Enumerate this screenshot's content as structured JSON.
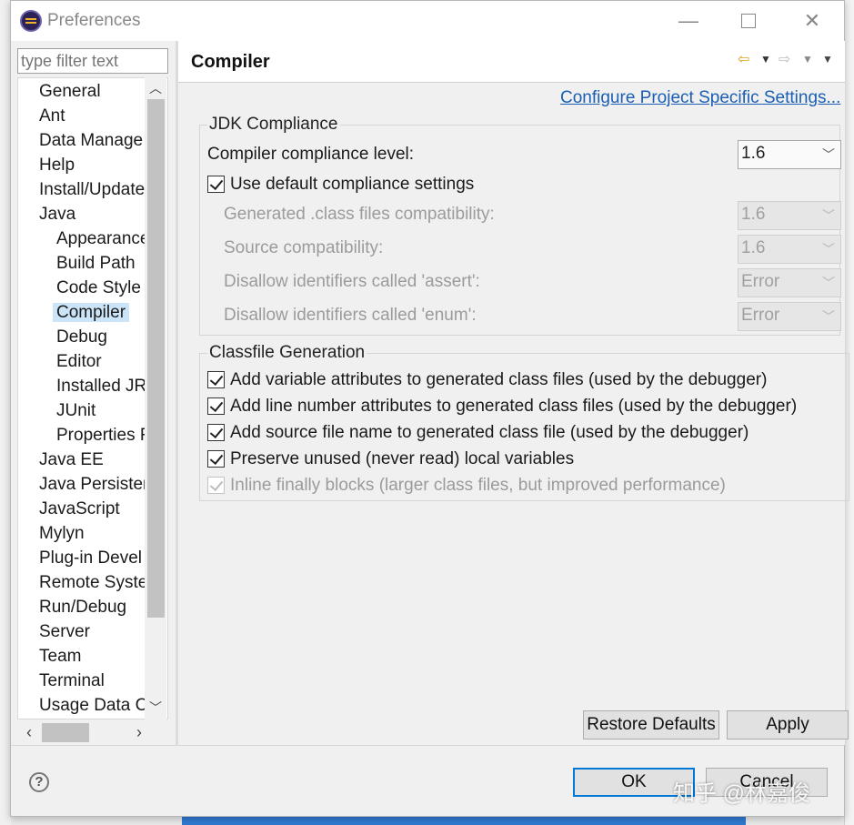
{
  "window": {
    "title": "Preferences",
    "minimize_glyph": "—",
    "close_glyph": "✕"
  },
  "filter": {
    "placeholder": "type filter text"
  },
  "tree": {
    "items": [
      {
        "label": "General",
        "level": 0
      },
      {
        "label": "Ant",
        "level": 0
      },
      {
        "label": "Data Manage",
        "level": 0
      },
      {
        "label": "Help",
        "level": 0
      },
      {
        "label": "Install/Update",
        "level": 0
      },
      {
        "label": "Java",
        "level": 0
      },
      {
        "label": "Appearance",
        "level": 1
      },
      {
        "label": "Build Path",
        "level": 1
      },
      {
        "label": "Code Style",
        "level": 1
      },
      {
        "label": "Compiler",
        "level": 1,
        "selected": true
      },
      {
        "label": "Debug",
        "level": 1
      },
      {
        "label": "Editor",
        "level": 1
      },
      {
        "label": "Installed JR",
        "level": 1
      },
      {
        "label": "JUnit",
        "level": 1
      },
      {
        "label": "Properties F",
        "level": 1
      },
      {
        "label": "Java EE",
        "level": 0
      },
      {
        "label": "Java Persisten",
        "level": 0
      },
      {
        "label": "JavaScript",
        "level": 0
      },
      {
        "label": "Mylyn",
        "level": 0
      },
      {
        "label": "Plug-in Devel",
        "level": 0
      },
      {
        "label": "Remote Syste",
        "level": 0
      },
      {
        "label": "Run/Debug",
        "level": 0
      },
      {
        "label": "Server",
        "level": 0
      },
      {
        "label": "Team",
        "level": 0
      },
      {
        "label": "Terminal",
        "level": 0
      },
      {
        "label": "Usage Data C",
        "level": 0
      }
    ]
  },
  "page": {
    "title": "Compiler",
    "config_link": "Configure Project Specific Settings...",
    "jdk": {
      "title": "JDK Compliance",
      "compliance_label": "Compiler compliance level:",
      "compliance_value": "1.6",
      "use_default_label": "Use default compliance settings",
      "generated_label": "Generated .class files compatibility:",
      "generated_value": "1.6",
      "source_label": "Source compatibility:",
      "source_value": "1.6",
      "assert_label": "Disallow identifiers called 'assert':",
      "assert_value": "Error",
      "enum_label": "Disallow identifiers called 'enum':",
      "enum_value": "Error"
    },
    "classfile": {
      "title": "Classfile Generation",
      "options": [
        {
          "label": "Add variable attributes to generated class files (used by the debugger)",
          "checked": true,
          "enabled": true
        },
        {
          "label": "Add line number attributes to generated class files (used by the debugger)",
          "checked": true,
          "enabled": true
        },
        {
          "label": "Add source file name to generated class file (used by the debugger)",
          "checked": true,
          "enabled": true
        },
        {
          "label": "Preserve unused (never read) local variables",
          "checked": true,
          "enabled": true
        },
        {
          "label": "Inline finally blocks (larger class files, but improved performance)",
          "checked": true,
          "enabled": false
        }
      ]
    },
    "restore_label": "Restore Defaults",
    "apply_label": "Apply"
  },
  "footer": {
    "ok_label": "OK",
    "cancel_label": "Cancel",
    "help_glyph": "?"
  },
  "watermark": "知乎 @林嘉俊"
}
